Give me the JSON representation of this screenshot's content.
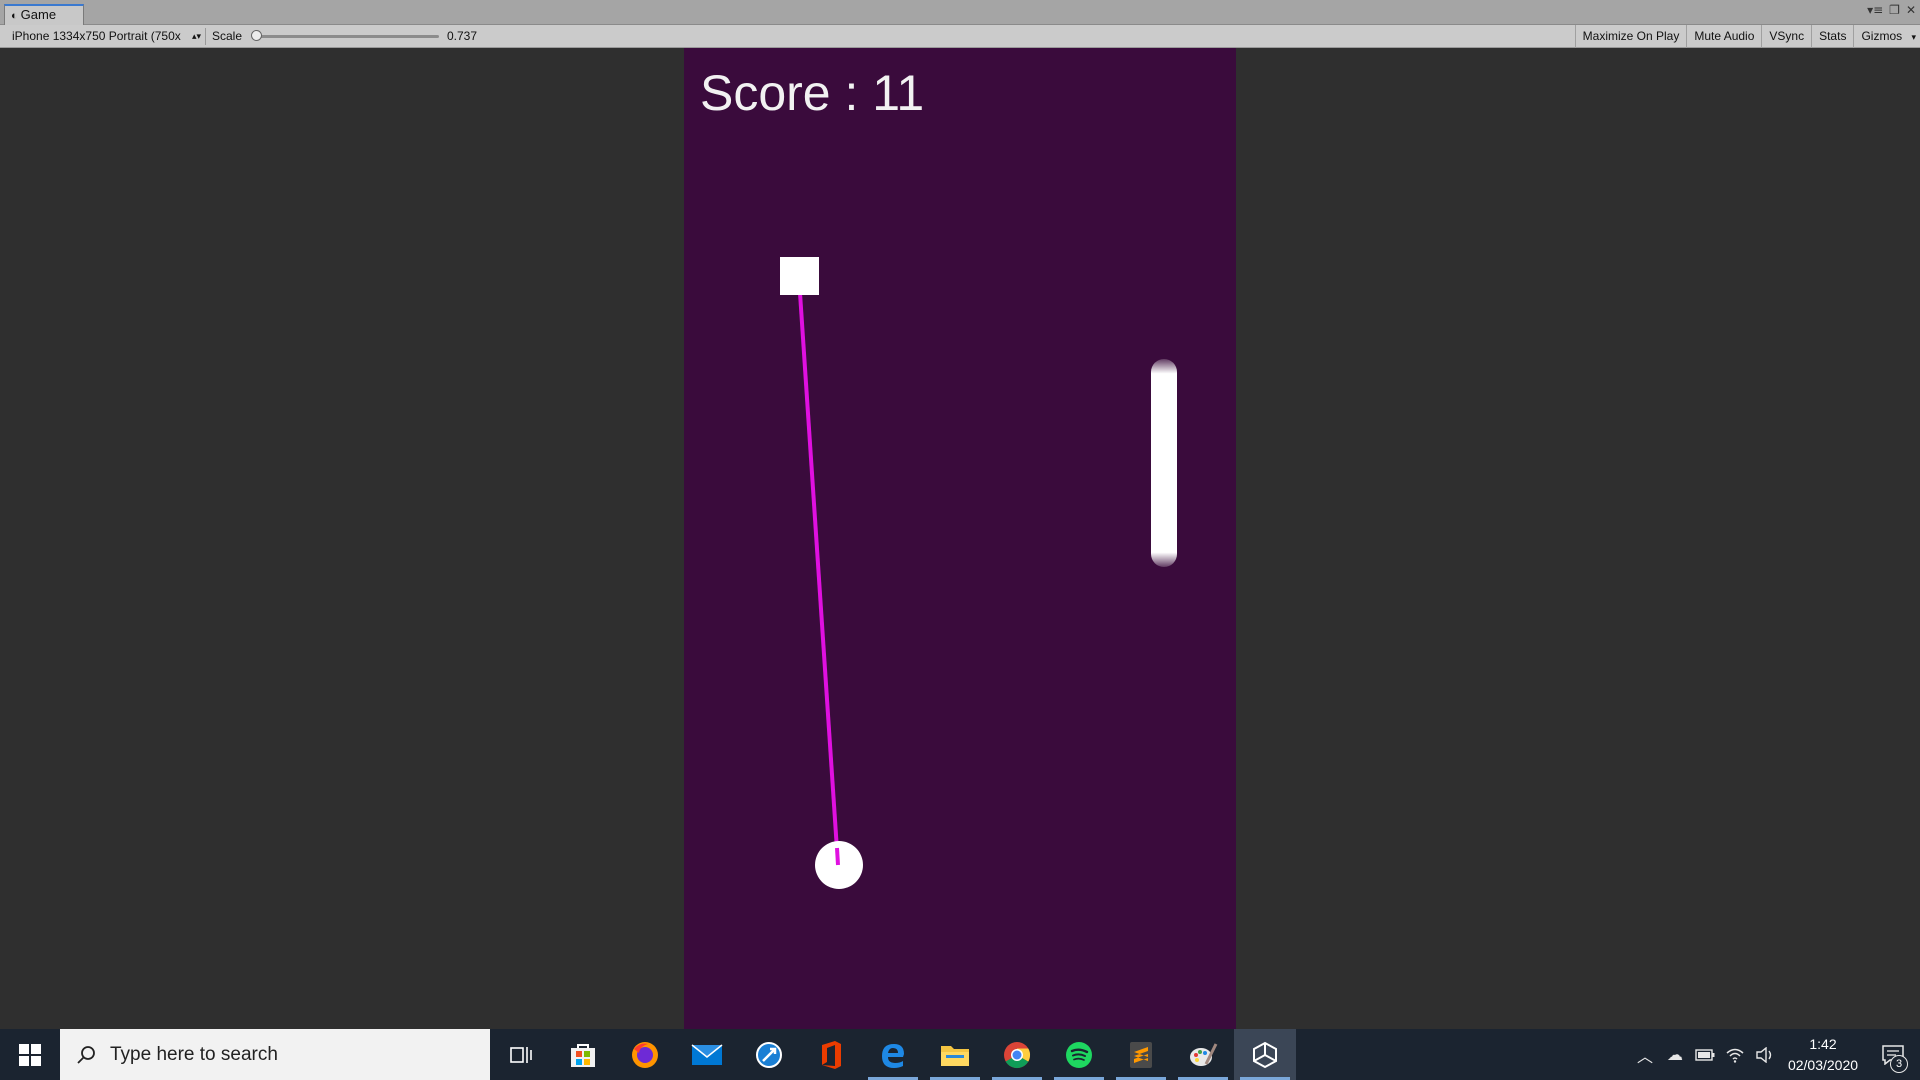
{
  "tab": {
    "title": "Game"
  },
  "toolbar": {
    "resolution": "iPhone 1334x750 Portrait (750x",
    "scale_label": "Scale",
    "scale_value": "0.737",
    "scale_fraction": 0.0,
    "maximize_on_play": "Maximize On Play",
    "mute_audio": "Mute Audio",
    "vsync": "VSync",
    "stats": "Stats",
    "gizmos": "Gizmos"
  },
  "game": {
    "score_text": "Score : 11",
    "background_color": "#3a0b3c",
    "rope_color": "#e010e0"
  },
  "taskbar": {
    "search_placeholder": "Type here to search",
    "apps": [
      "task-view-icon",
      "store-icon",
      "firefox-icon",
      "mail-icon",
      "network-tool-icon",
      "office-icon",
      "edge-icon",
      "file-explorer-icon",
      "chrome-icon",
      "spotify-icon",
      "sublime-icon",
      "paint-icon",
      "unity-icon"
    ],
    "time": "1:42",
    "date": "02/03/2020",
    "notification_count": "3"
  }
}
